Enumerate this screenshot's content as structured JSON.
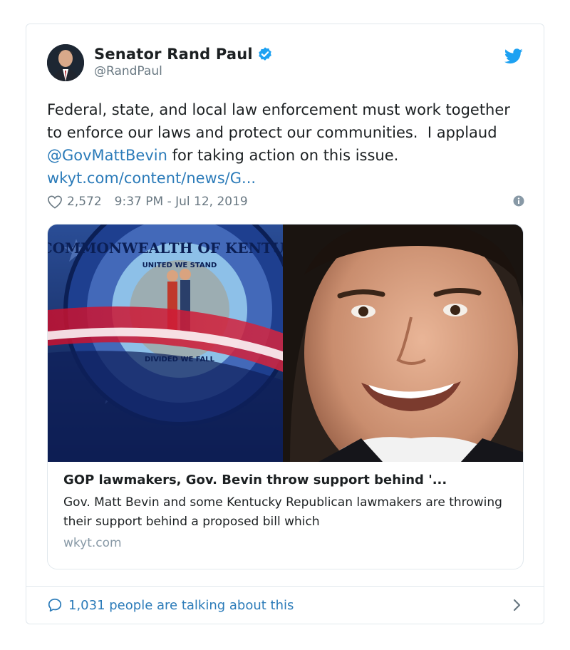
{
  "tweet": {
    "display_name": "Senator Rand Paul",
    "handle": "@RandPaul",
    "text_parts": {
      "t1": "Federal, state, and local law enforcement must work together to enforce our laws and protect our communities.  I applaud ",
      "mention": "@GovMattBevin",
      "t2": " for taking action on this issue. ",
      "url": "wkyt.com/content/news/G..."
    },
    "likes": "2,572",
    "timestamp": "9:37 PM - Jul 12, 2019"
  },
  "link_card": {
    "title": "GOP lawmakers, Gov. Bevin throw support behind '...",
    "description": "Gov. Matt Bevin and some Kentucky Republican lawmakers are throwing their support behind a proposed bill which",
    "domain": "wkyt.com",
    "seal_text_top": "COMMONWEALTH OF KENTUCKY",
    "seal_text_inner_top": "UNITED WE STAND",
    "seal_text_inner_bottom": "DIVIDED WE FALL"
  },
  "footer": {
    "talking": "1,031 people are talking about this"
  },
  "colors": {
    "link": "#2b7bb9",
    "verified": "#1da1f2",
    "muted": "#697882"
  },
  "icons": [
    "avatar",
    "verified-badge-icon",
    "twitter-bird-icon",
    "heart-icon",
    "info-icon",
    "speech-bubble-icon",
    "chevron-right-icon"
  ]
}
